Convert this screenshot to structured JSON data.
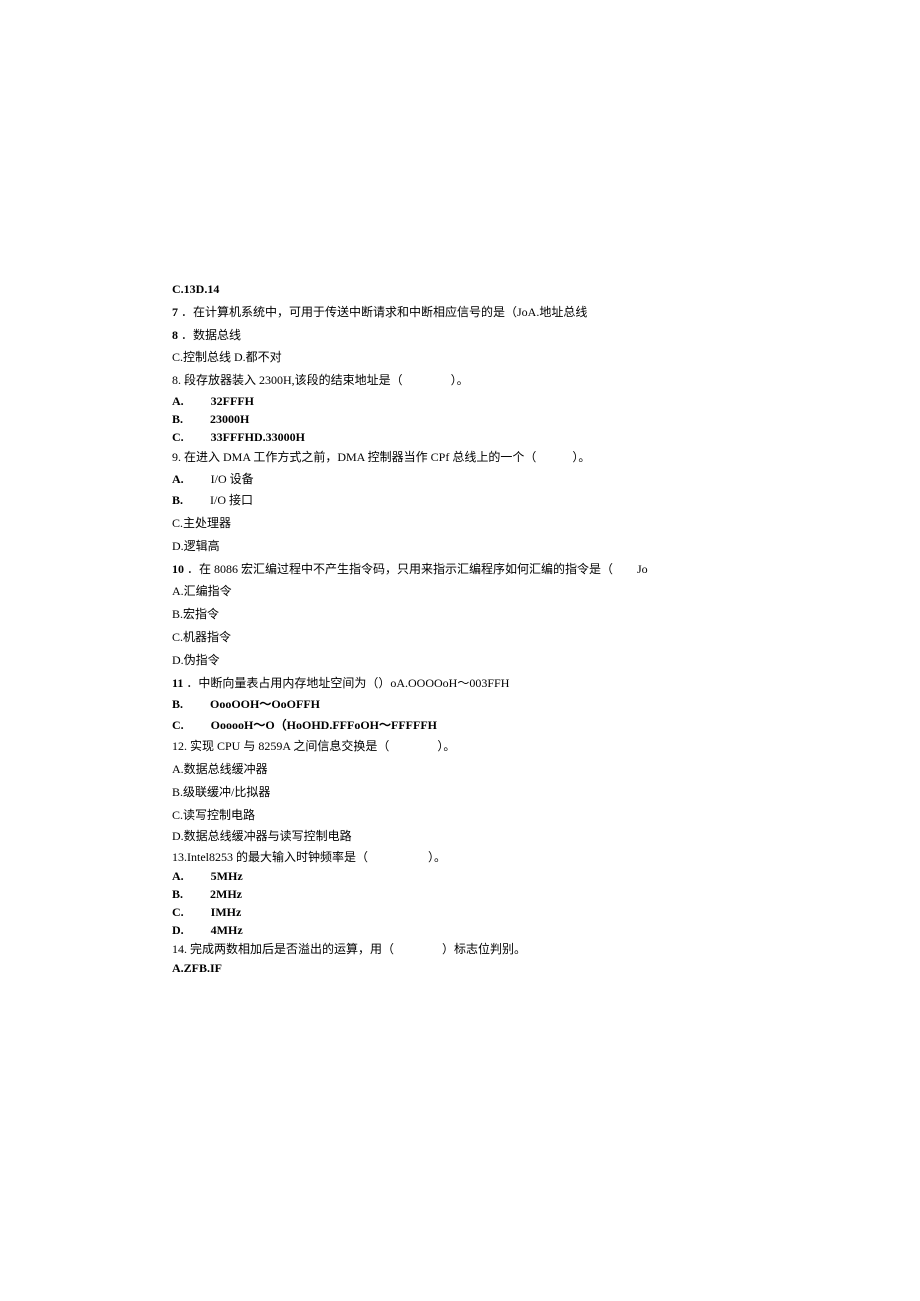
{
  "l1": "C.13D.14",
  "l2a": "7",
  "l2b": "．在计算机系统中，可用于传送中断请求和中断相应信号的是（JoA.地址总线",
  "l3a": "8",
  "l3b": "．数据总线",
  "l4": "C.控制总线 D.都不对",
  "l5": "8. 段存放器装入 2300H,该段的结束地址是（　　　　）。",
  "l6a": "A.",
  "l6b": "32FFFH",
  "l7a": "B.",
  "l7b": "23000H",
  "l8a": "C.",
  "l8b": "33FFFHD.33000H",
  "l9": "9. 在进入 DMA 工作方式之前，DMA 控制器当作 CPf 总线上的一个（　　　）。",
  "l10a": "A.",
  "l10b": "I/O 设备",
  "l11a": "B.",
  "l11b": "I/O 接口",
  "l12": "C.主处理器",
  "l13": "D.逻辑高",
  "l14a": "10",
  "l14b": "．在 8086 宏汇编过程中不产生指令码，只用来指示汇编程序如何汇编的指令是（　　Jo",
  "l15": "A.汇编指令",
  "l16": "B.宏指令",
  "l17": "C.机器指令",
  "l18": "D.伪指令",
  "l19a": "11",
  "l19b": "．中断向量表占用内存地址空间为（）oA.OOOOoH～003FFH",
  "l20a": "B.",
  "l20b": "OooOOH～OoOFFH",
  "l21a": "C.",
  "l21b": "OooooH～O（HoOHD.FFFoOH～FFFFFH",
  "l22": "12. 实现 CPU 与 8259A 之间信息交换是（　　　　）。",
  "l23": "A.数据总线缓冲器",
  "l24": "B.级联缓冲/比拟器",
  "l25": "C.读写控制电路",
  "l26": "D.数据总线缓冲器与读写控制电路",
  "l27": "13.Intel8253 的最大输入时钟频率是（　　　　　）。",
  "l28a": "A.",
  "l28b": "5MHz",
  "l29a": "B.",
  "l29b": "2MHz",
  "l30a": "C.",
  "l30b": "IMHz",
  "l31a": "D.",
  "l31b": "4MHz",
  "l32": "14. 完成两数相加后是否溢出的运算，用（　　　　）标志位判别。",
  "l33": "A.ZFB.IF"
}
